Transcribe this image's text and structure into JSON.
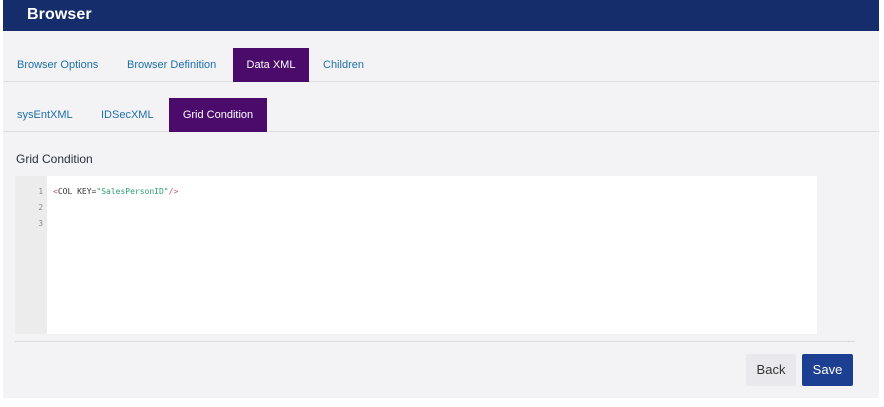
{
  "header": {
    "title": "Browser"
  },
  "main_tabs": [
    {
      "label": "Browser Options"
    },
    {
      "label": "Browser Definition"
    },
    {
      "label": "Data XML"
    },
    {
      "label": "Children"
    }
  ],
  "sub_tabs": [
    {
      "label": "sysEntXML"
    },
    {
      "label": "IDSecXML"
    },
    {
      "label": "Grid Condition"
    }
  ],
  "section": {
    "label": "Grid Condition"
  },
  "editor": {
    "line_numbers": [
      "1",
      "2",
      "3"
    ],
    "code": {
      "open": "<",
      "tag": "COL",
      "attr": " KEY=",
      "value": "\"SalesPersonID\"",
      "close": "/>"
    }
  },
  "actions": {
    "back": "Back",
    "save": "Save"
  }
}
